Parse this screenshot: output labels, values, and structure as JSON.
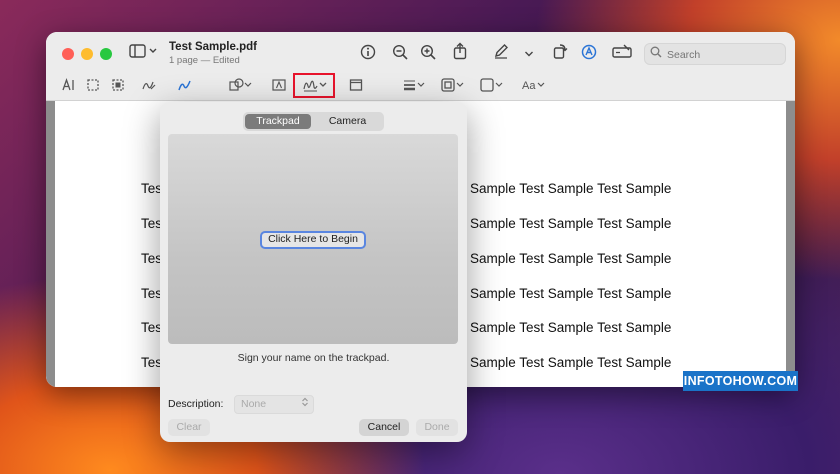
{
  "window": {
    "title": "Test Sample.pdf",
    "subtitle": "1 page — Edited"
  },
  "toolbar": {
    "search_placeholder": "Search"
  },
  "document": {
    "lines": [
      {
        "left": "Test",
        "right": "Sample Test Sample Test Sample"
      },
      {
        "left": "Tes",
        "right": "Sample Test Sample Test Sample"
      },
      {
        "left": "Tes",
        "right": "Sample Test Sample Test Sample"
      },
      {
        "left": "Tes",
        "right": "Sample Test Sample Test Sample"
      },
      {
        "left": "Tes",
        "right": "Sample Test Sample Test Sample"
      },
      {
        "left": "Tes",
        "right": "Sample Test Sample Test Sample"
      }
    ]
  },
  "signature_popup": {
    "tabs": [
      "Trackpad",
      "Camera"
    ],
    "active_tab": "Trackpad",
    "begin_label": "Click Here to Begin",
    "hint": "Sign your name on the trackpad.",
    "description_label": "Description:",
    "description_value": "None",
    "clear_label": "Clear",
    "cancel_label": "Cancel",
    "done_label": "Done"
  },
  "watermark": "INFOTOHOW.COM",
  "colors": {
    "highlight": "#e8142c",
    "focus_ring": "#5a86e0",
    "watermark_bg": "#1a73c8"
  },
  "icons": {
    "annotation_bar": [
      "text-selection-icon",
      "rect-selection-icon",
      "smart-lasso-icon",
      "sketch-icon",
      "draw-icon",
      "shapes-icon",
      "text-box-icon",
      "signature-icon",
      "note-icon",
      "line-style-icon",
      "border-color-icon",
      "fill-color-icon",
      "text-style-icon"
    ]
  }
}
